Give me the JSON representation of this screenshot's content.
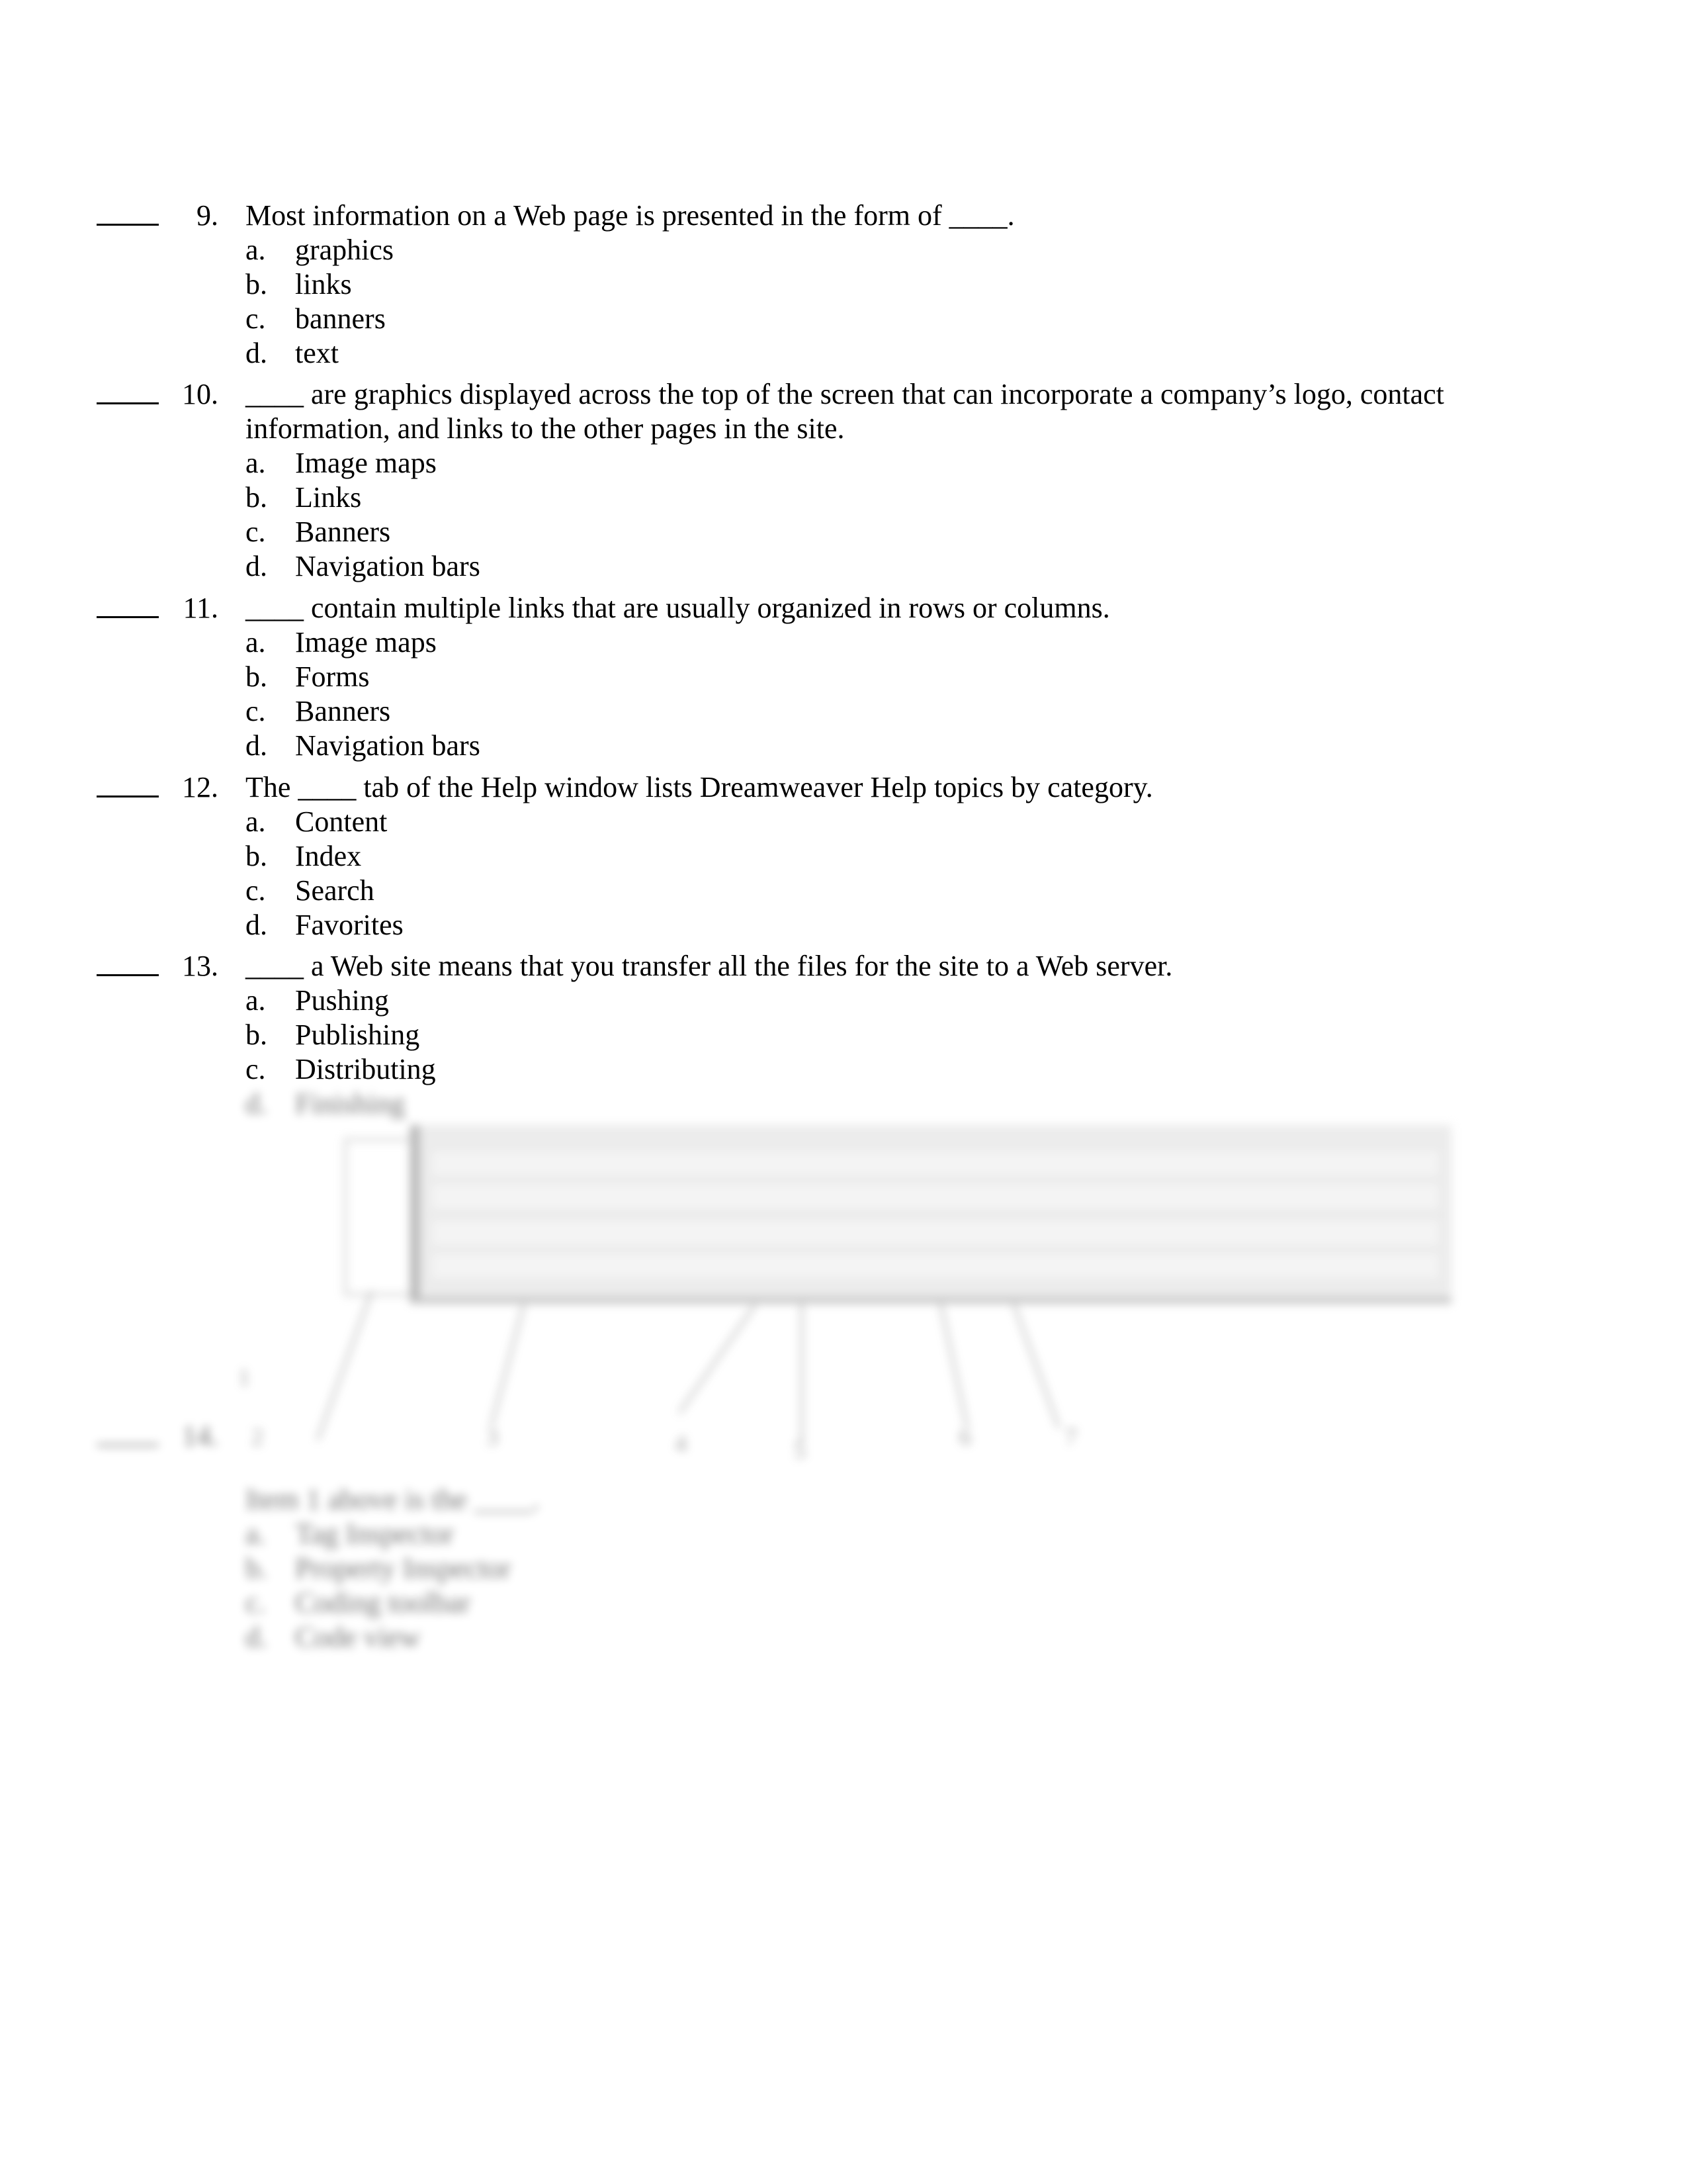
{
  "document": {
    "answer_blank": "____",
    "questions": [
      {
        "number": "9.",
        "text": "Most information on a Web page is presented in the form of ____.",
        "options": [
          {
            "letter": "a.",
            "text": "graphics"
          },
          {
            "letter": "b.",
            "text": "links"
          },
          {
            "letter": "c.",
            "text": "banners"
          },
          {
            "letter": "d.",
            "text": "text"
          }
        ]
      },
      {
        "number": "10.",
        "text": "____ are graphics displayed across the top of the screen that can incorporate a company’s logo, contact information, and links to the other pages in the site.",
        "options": [
          {
            "letter": "a.",
            "text": "Image maps"
          },
          {
            "letter": "b.",
            "text": "Links"
          },
          {
            "letter": "c.",
            "text": "Banners"
          },
          {
            "letter": "d.",
            "text": "Navigation bars"
          }
        ]
      },
      {
        "number": "11.",
        "text": "____ contain multiple links that are usually organized in rows or columns.",
        "options": [
          {
            "letter": "a.",
            "text": "Image maps"
          },
          {
            "letter": "b.",
            "text": "Forms"
          },
          {
            "letter": "c.",
            "text": "Banners"
          },
          {
            "letter": "d.",
            "text": "Navigation bars"
          }
        ]
      },
      {
        "number": "12.",
        "text": "The ____ tab of the Help window lists Dreamweaver Help topics by category.",
        "options": [
          {
            "letter": "a.",
            "text": "Content"
          },
          {
            "letter": "b.",
            "text": "Index"
          },
          {
            "letter": "c.",
            "text": "Search"
          },
          {
            "letter": "d.",
            "text": "Favorites"
          }
        ]
      },
      {
        "number": "13.",
        "text": "____ a Web site means that you transfer all the files for the site to a Web server.",
        "options": [
          {
            "letter": "a.",
            "text": "Pushing"
          },
          {
            "letter": "b.",
            "text": "Publishing"
          },
          {
            "letter": "c.",
            "text": "Distributing"
          },
          {
            "letter": "d.",
            "text": "Finishing"
          }
        ]
      },
      {
        "number": "14.",
        "text": "Item 1 above is the ____.",
        "options": [
          {
            "letter": "a.",
            "text": "Tag Inspector"
          },
          {
            "letter": "b.",
            "text": "Property Inspector"
          },
          {
            "letter": "c.",
            "text": "Coding toolbar"
          },
          {
            "letter": "d.",
            "text": "Code view"
          }
        ]
      }
    ],
    "figure": {
      "callouts": [
        "1",
        "2",
        "3",
        "4",
        "5",
        "6",
        "7"
      ]
    }
  }
}
